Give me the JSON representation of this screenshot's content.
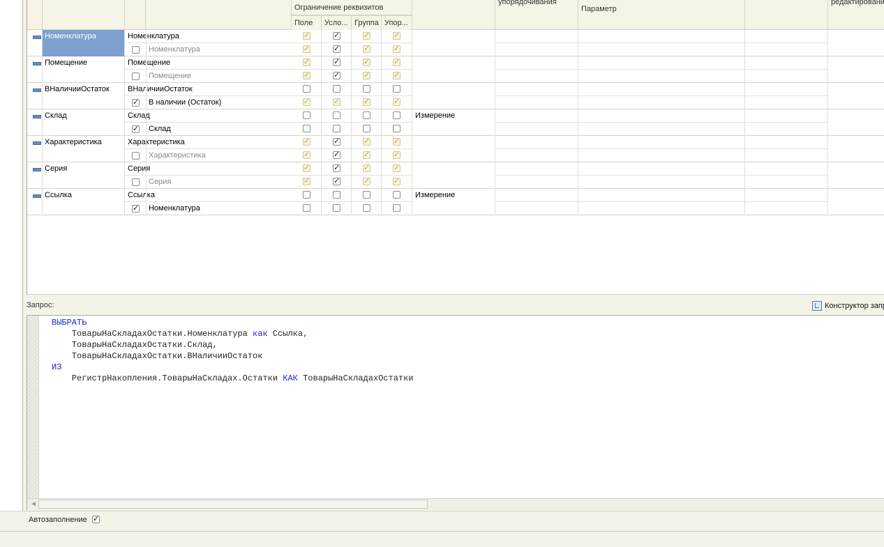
{
  "headers": {
    "restriction_group": "Ограничение реквизитов",
    "sub": [
      "Поле",
      "Усло...",
      "Группа",
      "Упор..."
    ],
    "ordering": "упорядочивания",
    "parameter": "Параметр",
    "editing": "редактировани"
  },
  "rows": [
    {
      "name": "Номенклатура",
      "field": "Номенклатура",
      "sub_label": "Номенклатура",
      "sub_checked": false,
      "sub_gray": true,
      "selected": true,
      "dim": true,
      "row1": [
        true,
        true,
        true,
        true
      ],
      "row2": [
        true,
        true,
        true,
        true
      ],
      "type": ""
    },
    {
      "name": "Помещение",
      "field": "Помещение",
      "sub_label": "Помещение",
      "sub_checked": false,
      "sub_gray": true,
      "selected": false,
      "dim": true,
      "row1": [
        true,
        true,
        true,
        true
      ],
      "row2": [
        true,
        true,
        true,
        true
      ],
      "type": ""
    },
    {
      "name": "ВНаличииОстаток",
      "field": "ВНаличииОстаток",
      "sub_label": "В наличии (Остаток)",
      "sub_checked": true,
      "sub_gray": false,
      "selected": false,
      "dim": false,
      "row1": [
        false,
        false,
        false,
        false
      ],
      "row2": [
        true,
        true,
        true,
        true
      ],
      "type": ""
    },
    {
      "name": "Склад",
      "field": "Склад",
      "sub_label": "Склад",
      "sub_checked": true,
      "sub_gray": false,
      "selected": false,
      "dim": false,
      "row1": [
        false,
        false,
        false,
        false
      ],
      "row2": [
        false,
        false,
        false,
        false
      ],
      "type": "Измерение"
    },
    {
      "name": "Характеристика",
      "field": "Характеристика",
      "sub_label": "Характеристика",
      "sub_checked": false,
      "sub_gray": true,
      "selected": false,
      "dim": true,
      "row1": [
        true,
        true,
        true,
        true
      ],
      "row2": [
        true,
        true,
        true,
        true
      ],
      "type": ""
    },
    {
      "name": "Серия",
      "field": "Серия",
      "sub_label": "Серия",
      "sub_checked": false,
      "sub_gray": true,
      "selected": false,
      "dim": true,
      "row1": [
        true,
        true,
        true,
        true
      ],
      "row2": [
        true,
        true,
        true,
        true
      ],
      "type": ""
    },
    {
      "name": "Ссылка",
      "field": "Ссылка",
      "sub_label": "Номенклатура",
      "sub_checked": true,
      "sub_gray": false,
      "selected": false,
      "dim": false,
      "row1": [
        false,
        false,
        false,
        false
      ],
      "row2": [
        false,
        false,
        false,
        false
      ],
      "type": "Измерение"
    }
  ],
  "query": {
    "label": "Запрос:",
    "constructor": "Конструктор запр",
    "lines": [
      [
        {
          "t": "ВЫБРАТЬ",
          "kw": true
        }
      ],
      [
        {
          "t": "    ТоварыНаСкладахОстатки.Номенклатура "
        },
        {
          "t": "как",
          "kw": true
        },
        {
          "t": " Ссылка"
        },
        {
          "t": ",",
          "kw": true
        }
      ],
      [
        {
          "t": "    ТоварыНаСкладахОстатки.Склад,"
        }
      ],
      [
        {
          "t": "    ТоварыНаСкладахОстатки.ВНаличииОстаток"
        }
      ],
      [
        {
          "t": "ИЗ",
          "kw": true
        }
      ],
      [
        {
          "t": "    РегистрНакопления.ТоварыНаСкладах.Остатки "
        },
        {
          "t": "КАК",
          "kw": true
        },
        {
          "t": " ТоварыНаСкладахОстатки"
        }
      ]
    ]
  },
  "autofill": {
    "label": "Автозаполнение",
    "checked": true
  }
}
